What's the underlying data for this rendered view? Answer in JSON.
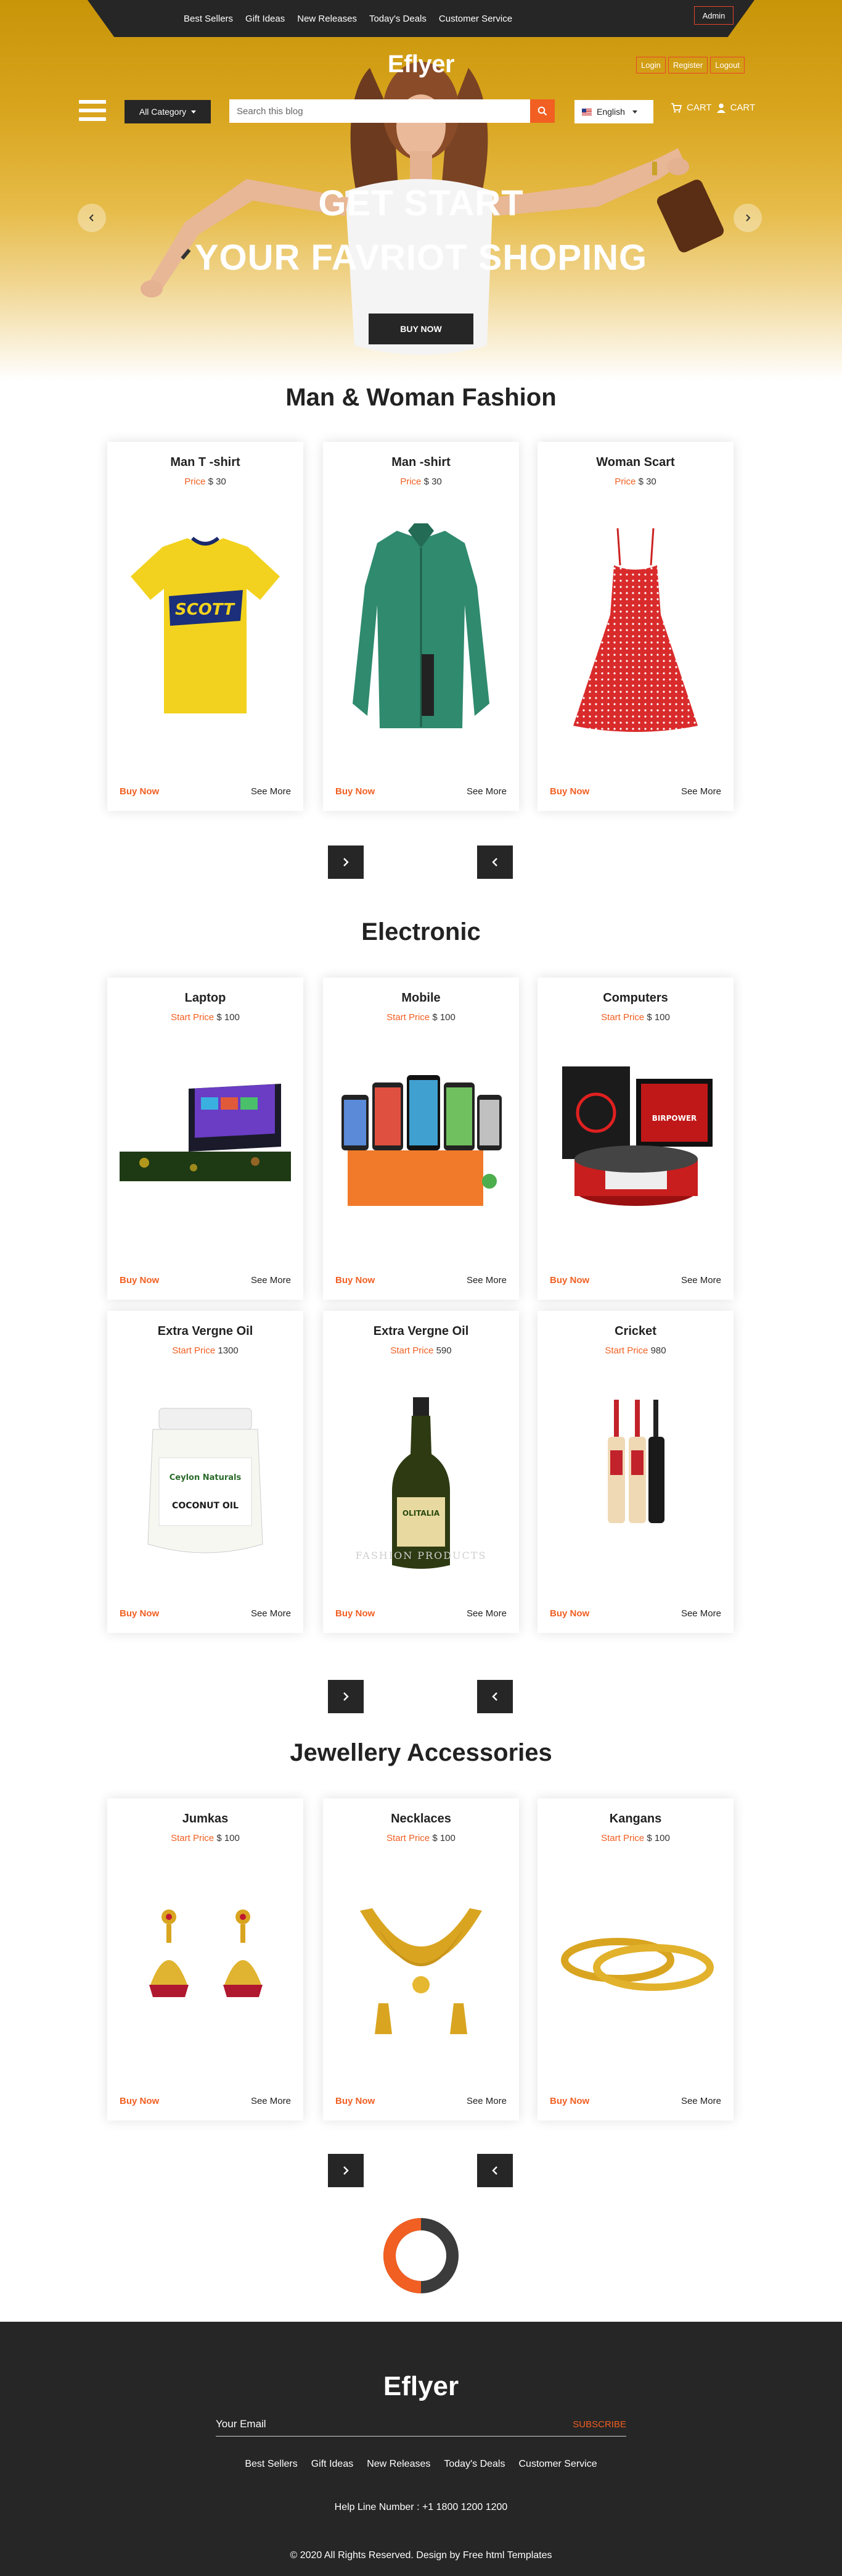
{
  "topnav": [
    "Best Sellers",
    "Gift Ideas",
    "New Releases",
    "Today's Deals",
    "Customer Service"
  ],
  "admin_label": "Admin",
  "brand": "Eflyer",
  "auth": [
    "Login",
    "Register",
    "Logout"
  ],
  "category_label": "All Category",
  "search_placeholder": "Search this blog",
  "language": "English",
  "cart_labels": [
    "CART",
    "CART"
  ],
  "hero": {
    "line1": "GET START",
    "line2": "YOUR FAVRIOT SHOPING",
    "button": "BUY NOW"
  },
  "sections": {
    "fashion": {
      "title": "Man & Woman Fashion",
      "cards": [
        {
          "name": "Man T -shirt",
          "price_label": "Price",
          "price": "$ 30",
          "image": "yellow-tshirt"
        },
        {
          "name": "Man -shirt",
          "price_label": "Price",
          "price": "$ 30",
          "image": "green-shirt"
        },
        {
          "name": "Woman Scart",
          "price_label": "Price",
          "price": "$ 30",
          "image": "red-dress"
        }
      ]
    },
    "electronic": {
      "title": "Electronic",
      "cards": [
        {
          "name": "Laptop",
          "price_label": "Start Price",
          "price": "$ 100",
          "image": "laptop"
        },
        {
          "name": "Mobile",
          "price_label": "Start Price",
          "price": "$ 100",
          "image": "mobiles"
        },
        {
          "name": "Computers",
          "price_label": "Start Price",
          "price": "$ 100",
          "image": "computer"
        },
        {
          "name": "Extra Vergne Oil",
          "price_label": "Start Price",
          "price": "1300",
          "image": "coconut-oil-jar"
        },
        {
          "name": "Extra Vergne Oil",
          "price_label": "Start Price",
          "price": "590",
          "image": "olive-oil-bottle"
        },
        {
          "name": "Cricket",
          "price_label": "Start Price",
          "price": "980",
          "image": "cricket-bats"
        }
      ]
    },
    "jewellery": {
      "title": "Jewellery Accessories",
      "cards": [
        {
          "name": "Jumkas",
          "price_label": "Start Price",
          "price": "$ 100",
          "image": "earrings"
        },
        {
          "name": "Necklaces",
          "price_label": "Start Price",
          "price": "$ 100",
          "image": "necklace"
        },
        {
          "name": "Kangans",
          "price_label": "Start Price",
          "price": "$ 100",
          "image": "bangles"
        }
      ]
    }
  },
  "card_actions": {
    "buy": "Buy Now",
    "more": "See More"
  },
  "watermark": "FASHION PRODUCTS",
  "product_text": {
    "coconut_brand": "Ceylon Naturals",
    "coconut_title": "COCONUT OIL",
    "olive_brand": "OLITALIA",
    "pc_brand": "BIRPOWER"
  },
  "footer": {
    "brand": "Eflyer",
    "email_placeholder": "Your Email",
    "subscribe": "SUBSCRIBE",
    "nav": [
      "Best Sellers",
      "Gift Ideas",
      "New Releases",
      "Today's Deals",
      "Customer Service"
    ],
    "help": "Help Line Number : +1 1800 1200 1200",
    "copyright": "© 2020 All Rights Reserved. Design by Free html Templates"
  },
  "colors": {
    "accent": "#f15f22",
    "dark": "#262626",
    "hero_gold": "#d8a41c"
  },
  "icons": [
    "menu-icon",
    "search-icon",
    "cart-icon",
    "user-icon",
    "chevron-left-icon",
    "chevron-right-icon",
    "loader-ring-icon"
  ]
}
